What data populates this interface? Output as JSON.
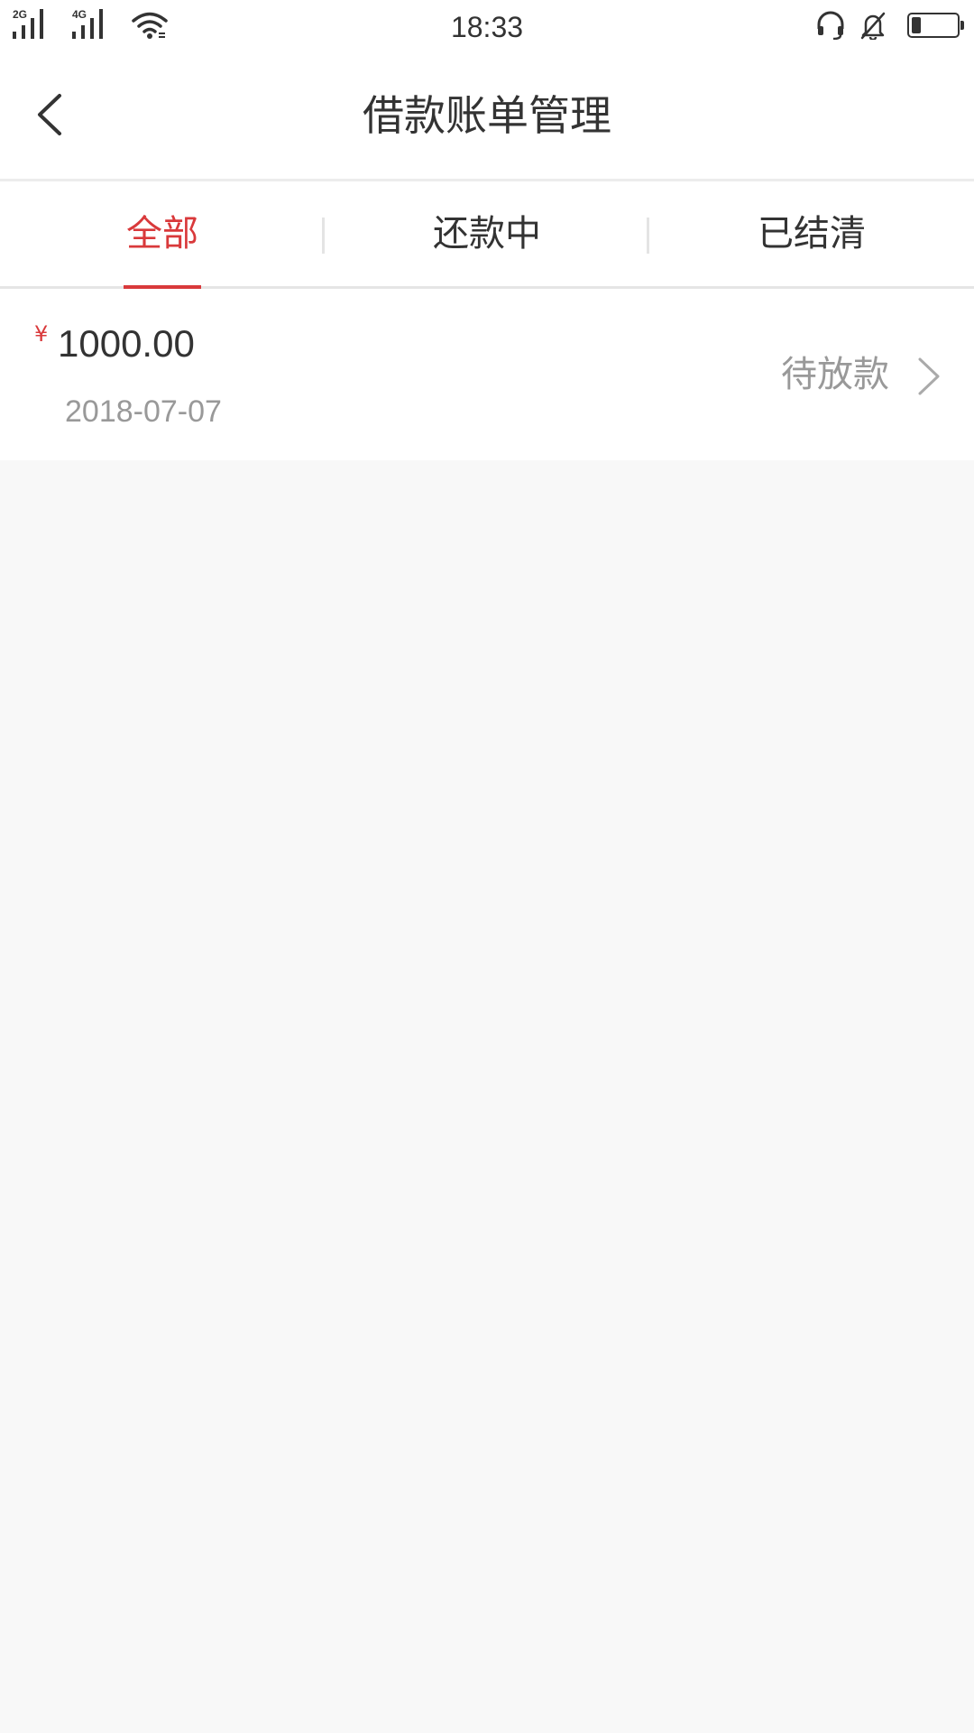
{
  "status_bar": {
    "time": "18:33",
    "sim1_network": "2G",
    "sim2_network": "4G",
    "battery_level": 0.2,
    "icons": [
      "signal-icon",
      "signal-icon",
      "wifi-icon",
      "headset-icon",
      "bell-off-icon",
      "battery-icon"
    ]
  },
  "header": {
    "title": "借款账单管理",
    "back_icon": "chevron-left-icon"
  },
  "tabs": [
    {
      "label": "全部",
      "active": true
    },
    {
      "label": "还款中",
      "active": false
    },
    {
      "label": "已结清",
      "active": false
    }
  ],
  "loans": [
    {
      "currency": "¥",
      "amount": "1000.00",
      "date": "2018-07-07",
      "status": "待放款"
    }
  ],
  "colors": {
    "accent": "#d9393b",
    "text_primary": "#333333",
    "text_secondary": "#999999",
    "background": "#f8f8f8"
  }
}
